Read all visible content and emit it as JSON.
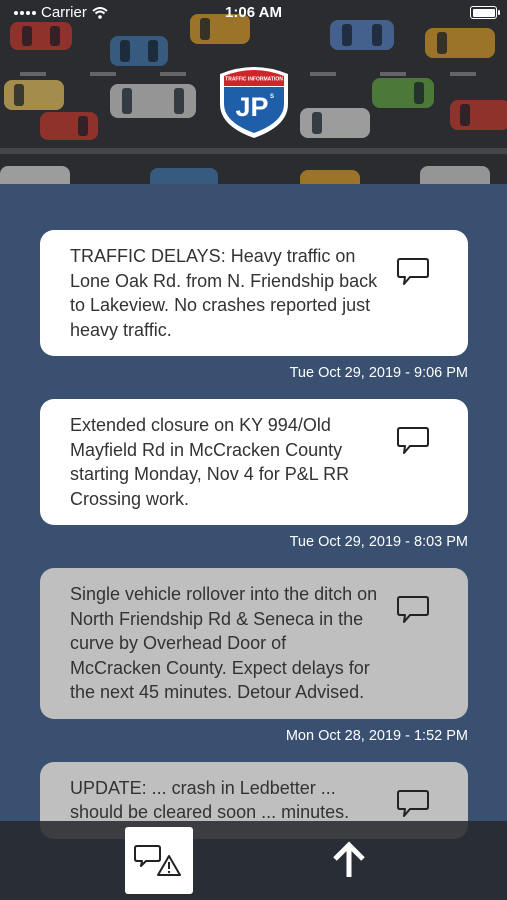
{
  "status_bar": {
    "carrier": "Carrier",
    "time": "1:06 AM"
  },
  "logo": {
    "banner_text": "TRAFFIC INFORMATION",
    "initials": "JP",
    "suffix": "S"
  },
  "feed": {
    "items": [
      {
        "text": "TRAFFIC DELAYS: Heavy traffic on Lone Oak Rd. from N. Friendship back to Lakeview. No crashes reported just heavy traffic.",
        "timestamp": "Tue Oct 29, 2019 - 9:06 PM",
        "read": false,
        "icon": "chat-bubble-icon"
      },
      {
        "text": "Extended closure on KY 994/Old Mayfield Rd in McCracken County starting Monday, Nov 4 for P&L RR Crossing work.",
        "timestamp": "Tue Oct 29, 2019 - 8:03 PM",
        "read": false,
        "icon": "chat-bubble-icon"
      },
      {
        "text": "Single vehicle rollover into the ditch on North Friendship Rd & Seneca in the curve by Overhead Door of McCracken County. Expect delays for the next 45 minutes. Detour Advised.",
        "timestamp": "Mon Oct 28, 2019 - 1:52 PM",
        "read": true,
        "icon": "chat-bubble-icon"
      },
      {
        "text": "UPDATE: ... crash in Ledbetter ... should be cleared soon ... minutes.",
        "timestamp": "",
        "read": true,
        "icon": "chat-bubble-icon"
      }
    ]
  },
  "bottom_bar": {
    "report_icon": "report-warning-icon",
    "scroll_icon": "arrow-up-icon"
  },
  "colors": {
    "background": "#3a5070",
    "card_unread": "#ffffff",
    "card_read": "#bfbfbf",
    "logo_red": "#d0242b",
    "logo_blue": "#1f5ea8"
  }
}
